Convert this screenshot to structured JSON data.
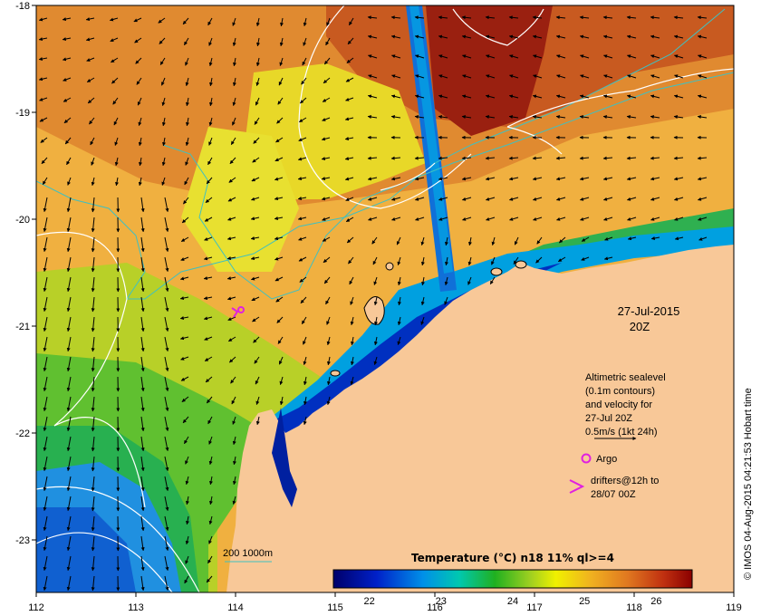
{
  "map": {
    "lon_ticks": [
      "112",
      "113",
      "114",
      "115",
      "116",
      "117",
      "118",
      "119"
    ],
    "lat_ticks": [
      "-18",
      "-19",
      "-20",
      "-21",
      "-22",
      "-23"
    ]
  },
  "annotation": {
    "date": "27-Jul-2015",
    "time": "20Z"
  },
  "legend_text": {
    "line1": "Altimetric sealevel",
    "line2": "(0.1m contours)",
    "line3": "and velocity for",
    "line4": "27-Jul 20Z",
    "line5": "0.5m/s (1kt 24h)"
  },
  "argo_label": "Argo",
  "drifters": {
    "line1": "drifters@12h to",
    "line2": "28/07 00Z"
  },
  "isobath_label": "200  1000m",
  "colorbar": {
    "title": "Temperature  (°C) n18 11% ql>=4",
    "tick_labels": [
      "22",
      "23",
      "24",
      "25",
      "26"
    ],
    "min": 21.5,
    "max": 26.5
  },
  "credit": "© IMOS 04-Aug-2015 04:21:53 Hobart time",
  "colors": {
    "land": "#f8c898",
    "argo": "#e020e0",
    "isobath": "#40c0c0",
    "contour": "#ffffff"
  }
}
